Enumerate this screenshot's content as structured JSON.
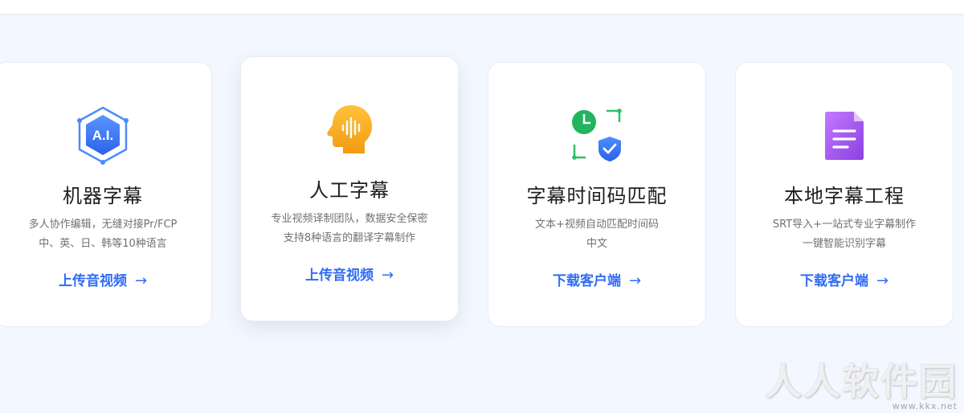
{
  "cards": [
    {
      "title": "机器字幕",
      "desc_line1": "多人协作编辑，无缝对接Pr/FCP",
      "desc_line2": "中、英、日、韩等10种语言",
      "link_label": "上传音视频",
      "arrow": "→",
      "icon": "ai-hexagon-icon",
      "icon_color": "#3d7cf5"
    },
    {
      "title": "人工字幕",
      "desc_line1": "专业视频译制团队，数据安全保密",
      "desc_line2": "支持8种语言的翻译字幕制作",
      "link_label": "上传音视频",
      "arrow": "→",
      "icon": "human-head-audio-icon",
      "icon_color": "#f7a51c"
    },
    {
      "title": "字幕时间码匹配",
      "desc_line1": "文本+视频自动匹配时间码",
      "desc_line2": "中文",
      "link_label": "下载客户端",
      "arrow": "→",
      "icon": "clock-shield-icon",
      "icon_color": "#23b45e"
    },
    {
      "title": "本地字幕工程",
      "desc_line1": "SRT导入+一站式专业字幕制作",
      "desc_line2": "一键智能识别字幕",
      "link_label": "下载客户端",
      "arrow": "→",
      "icon": "document-icon",
      "icon_color": "#a256e6"
    }
  ],
  "ai_icon_text": "A.I.",
  "watermark": {
    "main": "人人软件园",
    "sub": "www.kkx.net"
  },
  "colors": {
    "background": "#f3f7ff",
    "link": "#2f6cf6",
    "title": "#1f1f1f",
    "desc": "#707070"
  }
}
